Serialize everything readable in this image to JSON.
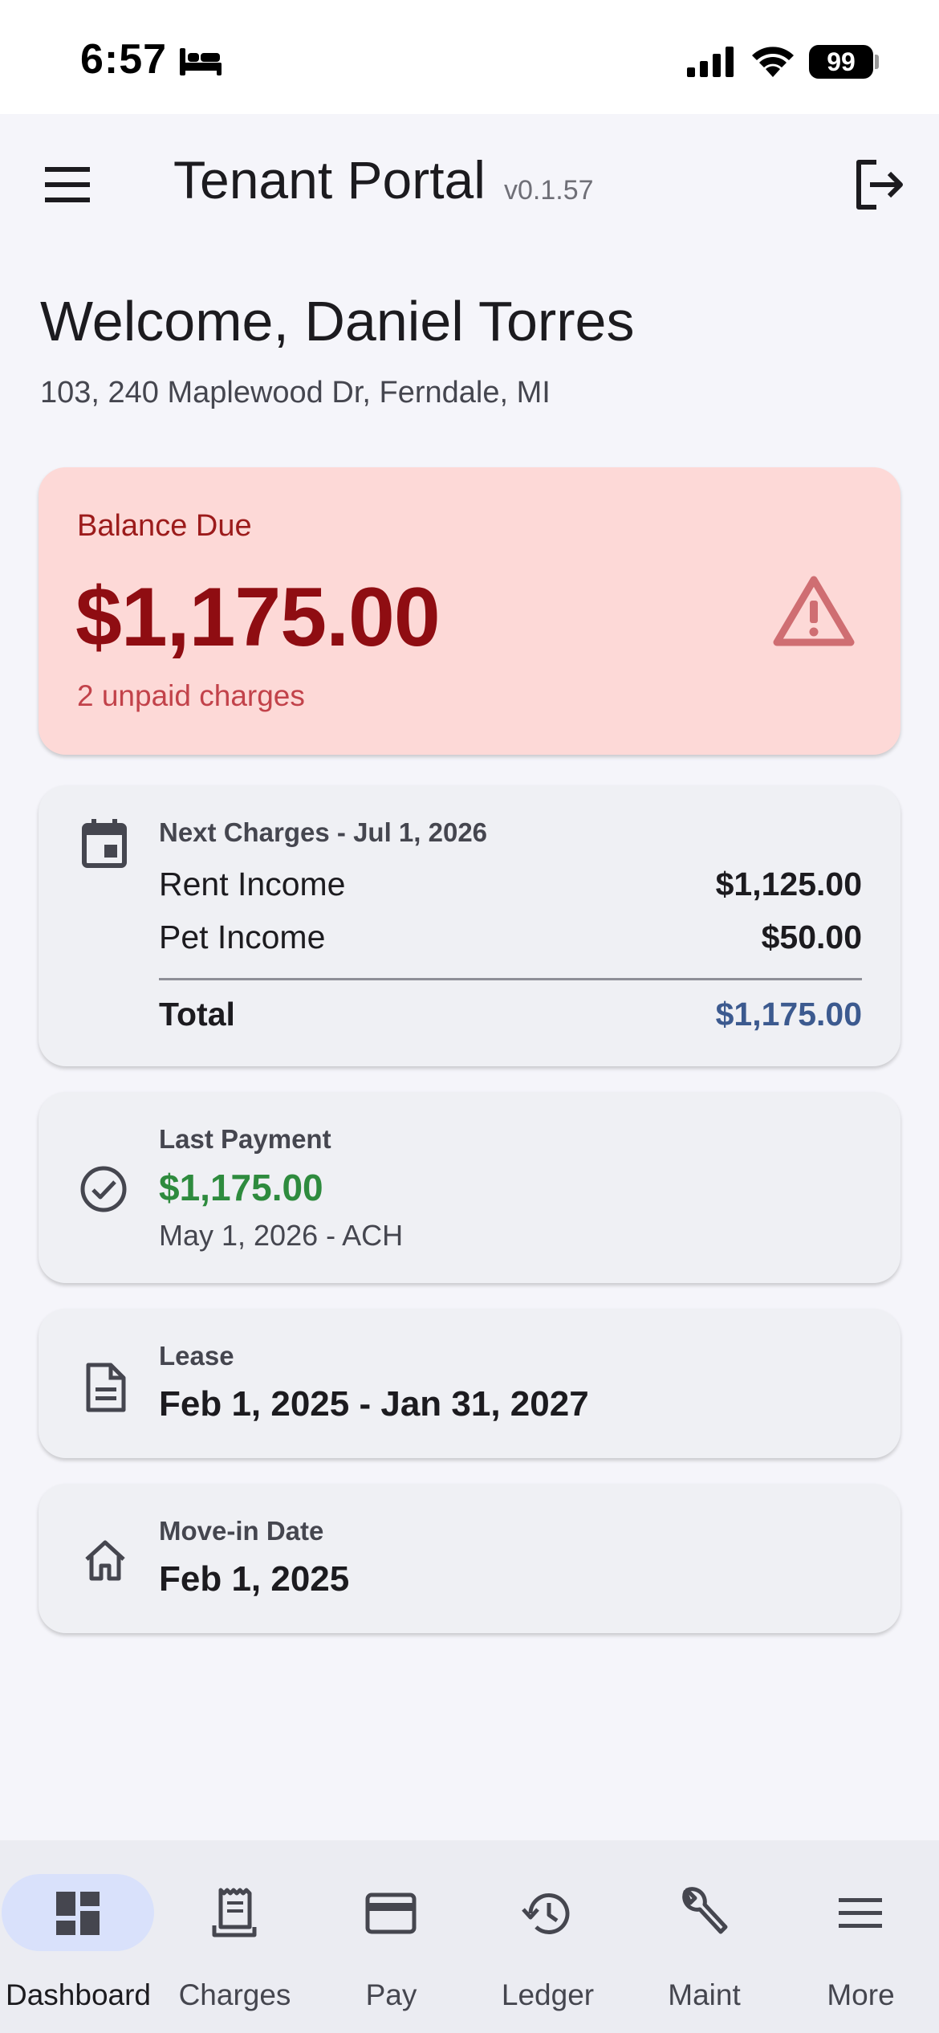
{
  "status_bar": {
    "time": "6:57",
    "focus_icon": "bed-icon",
    "battery": "99"
  },
  "app_bar": {
    "title": "Tenant Portal",
    "version": "v0.1.57",
    "menu_icon": "hamburger-menu-icon",
    "logout_icon": "logout-icon"
  },
  "welcome": {
    "heading": "Welcome, Daniel Torres",
    "address": "103, 240 Maplewood Dr, Ferndale, MI"
  },
  "balance_card": {
    "label": "Balance Due",
    "amount": "$1,175.00",
    "subtitle": "2 unpaid charges",
    "icon": "warning-icon"
  },
  "next_charges": {
    "title": "Next Charges - Jul 1, 2026",
    "items": [
      {
        "label": "Rent Income",
        "amount": "$1,125.00"
      },
      {
        "label": "Pet Income",
        "amount": "$50.00"
      }
    ],
    "total_label": "Total",
    "total_amount": "$1,175.00",
    "icon": "calendar-icon"
  },
  "last_payment": {
    "label": "Last Payment",
    "amount": "$1,175.00",
    "meta": "May 1, 2026 - ACH",
    "icon": "check-circle-icon"
  },
  "lease": {
    "label": "Lease",
    "value": "Feb 1, 2025 - Jan 31, 2027",
    "icon": "document-icon"
  },
  "move_in": {
    "label": "Move-in Date",
    "value": "Feb 1, 2025",
    "icon": "home-icon"
  },
  "bottom_nav": {
    "items": [
      {
        "label": "Dashboard",
        "icon": "dashboard-icon",
        "active": true
      },
      {
        "label": "Charges",
        "icon": "receipt-icon",
        "active": false
      },
      {
        "label": "Pay",
        "icon": "credit-card-icon",
        "active": false
      },
      {
        "label": "Ledger",
        "icon": "history-icon",
        "active": false
      },
      {
        "label": "Maint",
        "icon": "wrench-icon",
        "active": false
      },
      {
        "label": "More",
        "icon": "menu-icon",
        "active": false
      }
    ]
  },
  "colors": {
    "balance_bg": "#fdd9d7",
    "balance_text": "#8f0d12",
    "payment_green": "#2e8b3e",
    "total_blue": "#3c5a8f",
    "nav_active_pill": "#d9e1fb"
  }
}
